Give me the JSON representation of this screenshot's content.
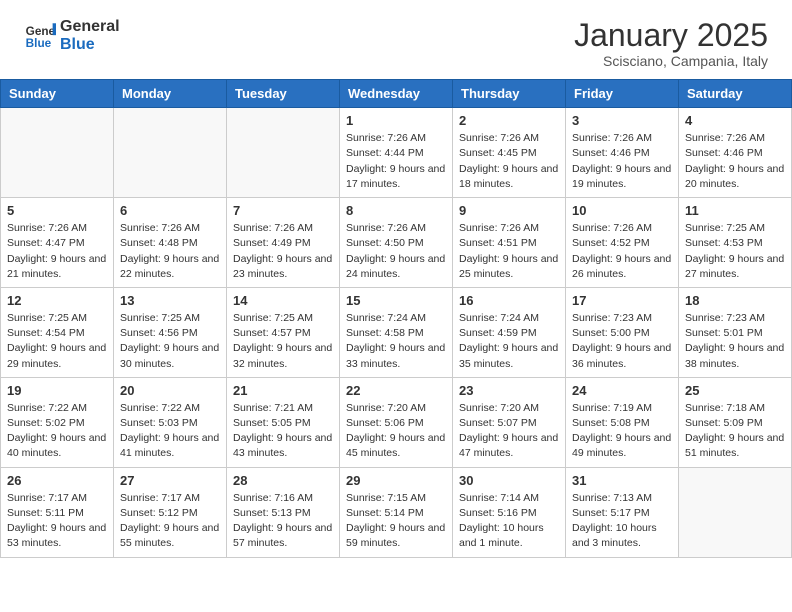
{
  "logo": {
    "general": "General",
    "blue": "Blue"
  },
  "header": {
    "month": "January 2025",
    "location": "Scisciano, Campania, Italy"
  },
  "weekdays": [
    "Sunday",
    "Monday",
    "Tuesday",
    "Wednesday",
    "Thursday",
    "Friday",
    "Saturday"
  ],
  "weeks": [
    [
      {
        "day": "",
        "sunrise": "",
        "sunset": "",
        "daylight": ""
      },
      {
        "day": "",
        "sunrise": "",
        "sunset": "",
        "daylight": ""
      },
      {
        "day": "",
        "sunrise": "",
        "sunset": "",
        "daylight": ""
      },
      {
        "day": "1",
        "sunrise": "Sunrise: 7:26 AM",
        "sunset": "Sunset: 4:44 PM",
        "daylight": "Daylight: 9 hours and 17 minutes."
      },
      {
        "day": "2",
        "sunrise": "Sunrise: 7:26 AM",
        "sunset": "Sunset: 4:45 PM",
        "daylight": "Daylight: 9 hours and 18 minutes."
      },
      {
        "day": "3",
        "sunrise": "Sunrise: 7:26 AM",
        "sunset": "Sunset: 4:46 PM",
        "daylight": "Daylight: 9 hours and 19 minutes."
      },
      {
        "day": "4",
        "sunrise": "Sunrise: 7:26 AM",
        "sunset": "Sunset: 4:46 PM",
        "daylight": "Daylight: 9 hours and 20 minutes."
      }
    ],
    [
      {
        "day": "5",
        "sunrise": "Sunrise: 7:26 AM",
        "sunset": "Sunset: 4:47 PM",
        "daylight": "Daylight: 9 hours and 21 minutes."
      },
      {
        "day": "6",
        "sunrise": "Sunrise: 7:26 AM",
        "sunset": "Sunset: 4:48 PM",
        "daylight": "Daylight: 9 hours and 22 minutes."
      },
      {
        "day": "7",
        "sunrise": "Sunrise: 7:26 AM",
        "sunset": "Sunset: 4:49 PM",
        "daylight": "Daylight: 9 hours and 23 minutes."
      },
      {
        "day": "8",
        "sunrise": "Sunrise: 7:26 AM",
        "sunset": "Sunset: 4:50 PM",
        "daylight": "Daylight: 9 hours and 24 minutes."
      },
      {
        "day": "9",
        "sunrise": "Sunrise: 7:26 AM",
        "sunset": "Sunset: 4:51 PM",
        "daylight": "Daylight: 9 hours and 25 minutes."
      },
      {
        "day": "10",
        "sunrise": "Sunrise: 7:26 AM",
        "sunset": "Sunset: 4:52 PM",
        "daylight": "Daylight: 9 hours and 26 minutes."
      },
      {
        "day": "11",
        "sunrise": "Sunrise: 7:25 AM",
        "sunset": "Sunset: 4:53 PM",
        "daylight": "Daylight: 9 hours and 27 minutes."
      }
    ],
    [
      {
        "day": "12",
        "sunrise": "Sunrise: 7:25 AM",
        "sunset": "Sunset: 4:54 PM",
        "daylight": "Daylight: 9 hours and 29 minutes."
      },
      {
        "day": "13",
        "sunrise": "Sunrise: 7:25 AM",
        "sunset": "Sunset: 4:56 PM",
        "daylight": "Daylight: 9 hours and 30 minutes."
      },
      {
        "day": "14",
        "sunrise": "Sunrise: 7:25 AM",
        "sunset": "Sunset: 4:57 PM",
        "daylight": "Daylight: 9 hours and 32 minutes."
      },
      {
        "day": "15",
        "sunrise": "Sunrise: 7:24 AM",
        "sunset": "Sunset: 4:58 PM",
        "daylight": "Daylight: 9 hours and 33 minutes."
      },
      {
        "day": "16",
        "sunrise": "Sunrise: 7:24 AM",
        "sunset": "Sunset: 4:59 PM",
        "daylight": "Daylight: 9 hours and 35 minutes."
      },
      {
        "day": "17",
        "sunrise": "Sunrise: 7:23 AM",
        "sunset": "Sunset: 5:00 PM",
        "daylight": "Daylight: 9 hours and 36 minutes."
      },
      {
        "day": "18",
        "sunrise": "Sunrise: 7:23 AM",
        "sunset": "Sunset: 5:01 PM",
        "daylight": "Daylight: 9 hours and 38 minutes."
      }
    ],
    [
      {
        "day": "19",
        "sunrise": "Sunrise: 7:22 AM",
        "sunset": "Sunset: 5:02 PM",
        "daylight": "Daylight: 9 hours and 40 minutes."
      },
      {
        "day": "20",
        "sunrise": "Sunrise: 7:22 AM",
        "sunset": "Sunset: 5:03 PM",
        "daylight": "Daylight: 9 hours and 41 minutes."
      },
      {
        "day": "21",
        "sunrise": "Sunrise: 7:21 AM",
        "sunset": "Sunset: 5:05 PM",
        "daylight": "Daylight: 9 hours and 43 minutes."
      },
      {
        "day": "22",
        "sunrise": "Sunrise: 7:20 AM",
        "sunset": "Sunset: 5:06 PM",
        "daylight": "Daylight: 9 hours and 45 minutes."
      },
      {
        "day": "23",
        "sunrise": "Sunrise: 7:20 AM",
        "sunset": "Sunset: 5:07 PM",
        "daylight": "Daylight: 9 hours and 47 minutes."
      },
      {
        "day": "24",
        "sunrise": "Sunrise: 7:19 AM",
        "sunset": "Sunset: 5:08 PM",
        "daylight": "Daylight: 9 hours and 49 minutes."
      },
      {
        "day": "25",
        "sunrise": "Sunrise: 7:18 AM",
        "sunset": "Sunset: 5:09 PM",
        "daylight": "Daylight: 9 hours and 51 minutes."
      }
    ],
    [
      {
        "day": "26",
        "sunrise": "Sunrise: 7:17 AM",
        "sunset": "Sunset: 5:11 PM",
        "daylight": "Daylight: 9 hours and 53 minutes."
      },
      {
        "day": "27",
        "sunrise": "Sunrise: 7:17 AM",
        "sunset": "Sunset: 5:12 PM",
        "daylight": "Daylight: 9 hours and 55 minutes."
      },
      {
        "day": "28",
        "sunrise": "Sunrise: 7:16 AM",
        "sunset": "Sunset: 5:13 PM",
        "daylight": "Daylight: 9 hours and 57 minutes."
      },
      {
        "day": "29",
        "sunrise": "Sunrise: 7:15 AM",
        "sunset": "Sunset: 5:14 PM",
        "daylight": "Daylight: 9 hours and 59 minutes."
      },
      {
        "day": "30",
        "sunrise": "Sunrise: 7:14 AM",
        "sunset": "Sunset: 5:16 PM",
        "daylight": "Daylight: 10 hours and 1 minute."
      },
      {
        "day": "31",
        "sunrise": "Sunrise: 7:13 AM",
        "sunset": "Sunset: 5:17 PM",
        "daylight": "Daylight: 10 hours and 3 minutes."
      },
      {
        "day": "",
        "sunrise": "",
        "sunset": "",
        "daylight": ""
      }
    ]
  ]
}
